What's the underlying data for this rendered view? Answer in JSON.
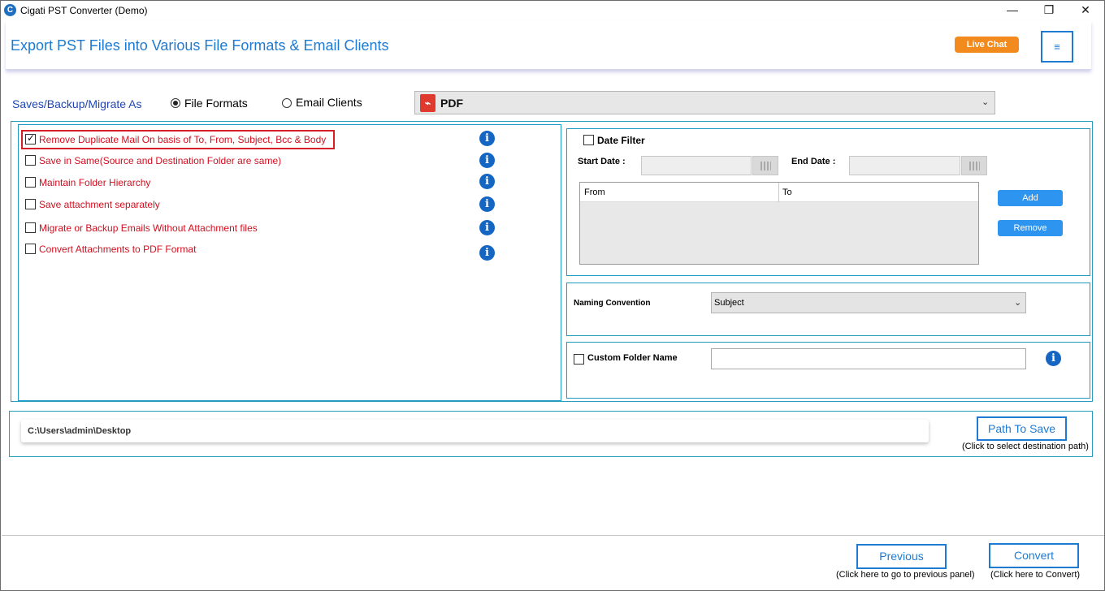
{
  "window": {
    "title": "Cigati PST Converter (Demo)",
    "controls": {
      "minimize": "—",
      "maximize": "❐",
      "close": "✕"
    }
  },
  "header": {
    "title": "Export PST Files into Various File Formats & Email Clients",
    "live_chat": "Live Chat",
    "menu_icon": "≡"
  },
  "save_as": {
    "label": "Saves/Backup/Migrate As",
    "options": [
      {
        "label": "File Formats",
        "selected": true
      },
      {
        "label": "Email Clients",
        "selected": false
      }
    ],
    "format_selected": "PDF",
    "format_icon": "pdf-icon"
  },
  "options": [
    {
      "label": "Remove Duplicate Mail On basis of To, From, Subject, Bcc & Body",
      "checked": true
    },
    {
      "label": "Save in Same(Source and Destination Folder are same)",
      "checked": false
    },
    {
      "label": "Maintain Folder Hierarchy",
      "checked": false
    },
    {
      "label": "Save attachment separately",
      "checked": false
    },
    {
      "label": "Migrate or Backup Emails Without Attachment files",
      "checked": false
    },
    {
      "label": "Convert Attachments to PDF Format",
      "checked": false
    }
  ],
  "date_filter": {
    "label": "Date Filter",
    "start_label": "Start Date :",
    "end_label": "End Date :",
    "start_value": "",
    "end_value": "",
    "columns": [
      "From",
      "To"
    ],
    "add_label": "Add",
    "remove_label": "Remove"
  },
  "naming": {
    "label": "Naming Convention",
    "selected": "Subject"
  },
  "custom_folder": {
    "label": "Custom Folder Name",
    "value": ""
  },
  "path": {
    "value": "C:\\Users\\admin\\Desktop",
    "button": "Path To Save",
    "hint": "(Click to select destination path)"
  },
  "footer": {
    "previous": "Previous",
    "previous_hint": "(Click here to go to previous panel)",
    "convert": "Convert",
    "convert_hint": "(Click here to Convert)"
  },
  "colors": {
    "accent_blue": "#1f7ad1",
    "live_chat_orange": "#f28a1d",
    "option_red": "#d10f1f",
    "button_blue": "#2d95f0"
  }
}
